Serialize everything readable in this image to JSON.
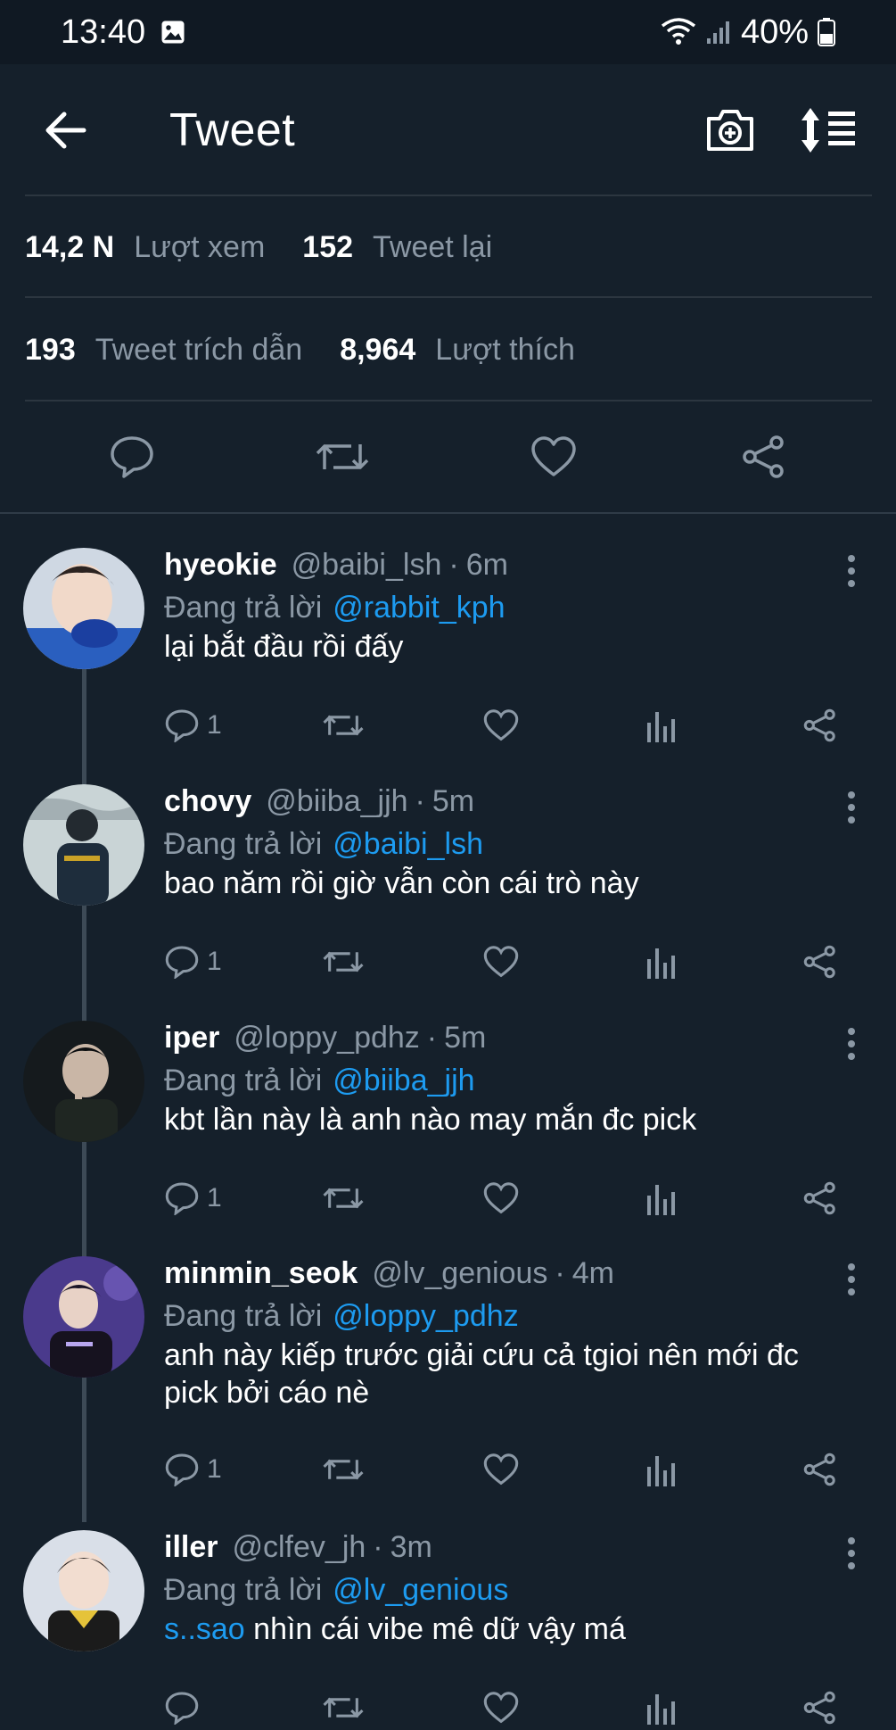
{
  "status": {
    "time": "13:40",
    "battery": "40%"
  },
  "appbar": {
    "title": "Tweet"
  },
  "stats": {
    "views_num": "14,2 N",
    "views_label": "Lượt xem",
    "retweets_num": "152",
    "retweets_label": "Tweet lại",
    "quotes_num": "193",
    "quotes_label": "Tweet trích dẫn",
    "likes_num": "8,964",
    "likes_label": "Lượt thích"
  },
  "replies": [
    {
      "name": "hyeokie",
      "handle": "@baibi_lsh",
      "sep": "·",
      "age": "6m",
      "replying_label": "Đang trả lời",
      "replying_to": "@rabbit_kph",
      "text": "lại bắt đầu rồi đấy",
      "reply_count": "1"
    },
    {
      "name": "chovy",
      "handle": "@biiba_jjh",
      "sep": "·",
      "age": "5m",
      "replying_label": "Đang trả lời",
      "replying_to": "@baibi_lsh",
      "text": "bao năm rồi giờ vẫn còn cái trò này",
      "reply_count": "1"
    },
    {
      "name": "iper",
      "handle": "@loppy_pdhz",
      "sep": "·",
      "age": "5m",
      "replying_label": "Đang trả lời",
      "replying_to": "@biiba_jjh",
      "text": "kbt lần này là anh nào may mắn đc pick",
      "reply_count": "1"
    },
    {
      "name": "minmin_seok",
      "handle": "@lv_genious",
      "sep": "·",
      "age": "4m",
      "replying_label": "Đang trả lời",
      "replying_to": "@loppy_pdhz",
      "text_line1": "anh này kiếp trước giải cứu cả tgioi nên mới đc",
      "text_line2": "pick bởi cáo nè",
      "reply_count": "1"
    },
    {
      "name": "iller",
      "handle": "@clfev_jh",
      "sep": "·",
      "age": "3m",
      "replying_label": "Đang trả lời",
      "replying_to": "@lv_genious",
      "text_mention": "s..sao",
      "text_rest": " nhìn cái vibe mê dữ vậy má"
    }
  ],
  "colors": {
    "background": "#15202b",
    "accent": "#1d9bf0",
    "muted": "#8b98a5"
  },
  "icons": [
    "back-arrow-icon",
    "camera-plus-icon",
    "sort-icon",
    "comment-icon",
    "retweet-icon",
    "heart-icon",
    "analytics-icon",
    "share-icon",
    "more-vertical-icon"
  ]
}
